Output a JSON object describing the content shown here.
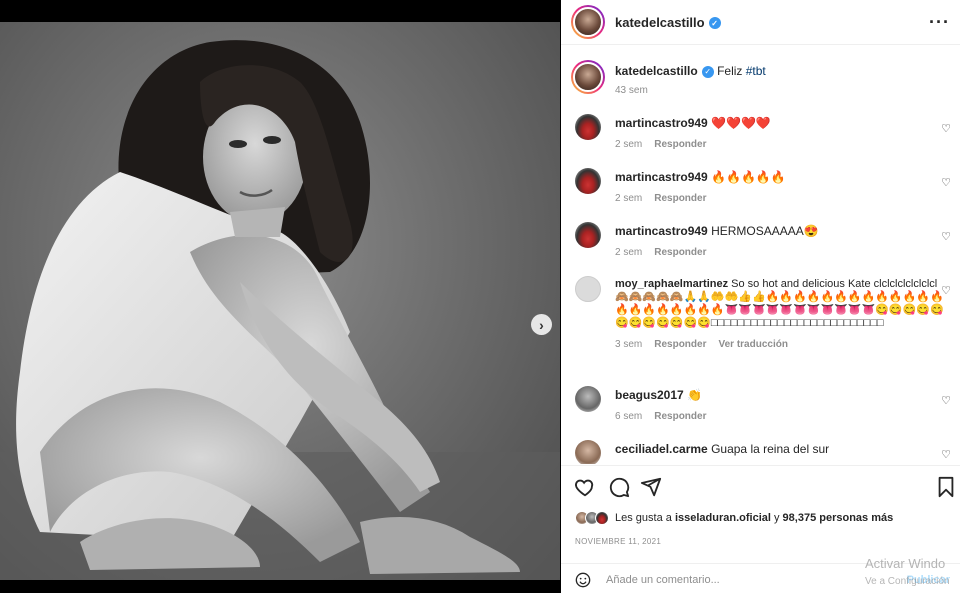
{
  "post": {
    "username": "katedelcastillo",
    "verified": true,
    "more_icon": "ellipsis-icon",
    "caption": {
      "text": "Feliz ",
      "hashtag": "#tbt",
      "time": "43 sem"
    },
    "image_alt": "Black and white portrait photo",
    "carousel": {
      "current": 1,
      "total": 2
    }
  },
  "comments": [
    {
      "user": "martincastro949",
      "text": "❤️❤️❤️❤️",
      "time": "2 sem",
      "reply": "Responder"
    },
    {
      "user": "martincastro949",
      "text": "🔥🔥🔥🔥🔥",
      "time": "2 sem",
      "reply": "Responder"
    },
    {
      "user": "martincastro949",
      "text": "HERMOSAAAAA😍",
      "time": "2 sem",
      "reply": "Responder"
    },
    {
      "user": "moy_raphaelmartinez",
      "text": "So so hot and delicious Kate clclclclclclclcl🙈🙈🙈🙈🙈🙏🙏🤲🤲👍👍🔥🔥🔥🔥🔥🔥🔥🔥🔥🔥🔥🔥🔥🔥🔥🔥🔥🔥🔥🔥🔥👅👅👅👅👅👅👅👅👅👅👅😋😋😋😋😋😋😋😋😋😋😋😋□□□□□□□□□□□□□□□□□□□□□□□□□□",
      "time": "3 sem",
      "reply": "Responder",
      "translate": "Ver traducción"
    },
    {
      "user": "beagus2017",
      "text": "👏",
      "time": "6 sem",
      "reply": "Responder"
    },
    {
      "user": "ceciliadel.carme",
      "text": "Guapa la reina del sur",
      "time": "",
      "reply": ""
    }
  ],
  "likes": {
    "prefix": "Les gusta a ",
    "user": "isseladuran.oficial",
    "middle": " y ",
    "count": "98,375 personas más"
  },
  "date": "NOVIEMBRE 11, 2021",
  "add_comment": {
    "placeholder": "Añade un comentario...",
    "publish": "Publicar"
  },
  "watermark": {
    "line1": "Activar Windo",
    "line2": "Ve a Configuración"
  },
  "icons": {
    "like": "heart-icon",
    "comment": "comment-icon",
    "share": "share-icon",
    "save": "bookmark-icon",
    "emoji": "emoji-icon",
    "next": "chevron-right-icon"
  }
}
